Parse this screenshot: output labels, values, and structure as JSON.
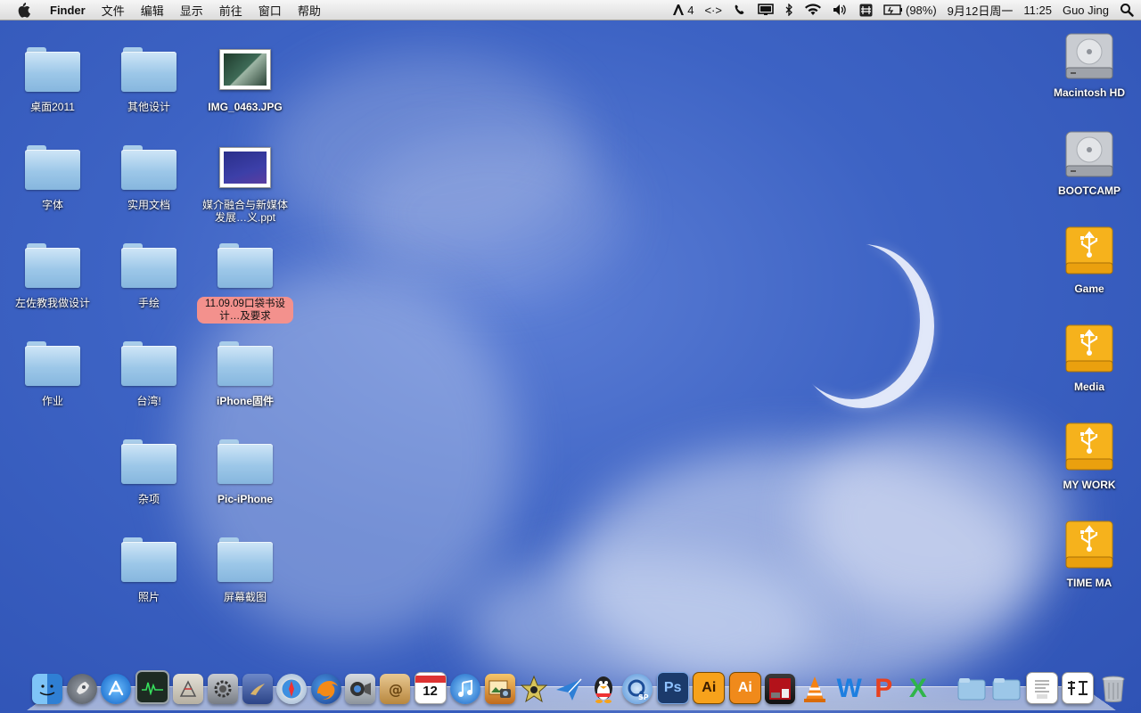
{
  "menubar": {
    "app_name": "Finder",
    "menus": [
      "文件",
      "编辑",
      "显示",
      "前往",
      "窗口",
      "帮助"
    ],
    "status": {
      "adobe_count": "4",
      "arrows": "<·>",
      "battery": "(98%)",
      "date": "9月12日周一",
      "time": "11:25",
      "user": "Guo Jing"
    }
  },
  "desktop_left": [
    {
      "label": "桌面2011",
      "kind": "folder"
    },
    {
      "label": "其他设计",
      "kind": "folder"
    },
    {
      "label": "IMG_0463.JPG",
      "kind": "image"
    },
    {
      "label": "字体",
      "kind": "folder"
    },
    {
      "label": "实用文档",
      "kind": "folder"
    },
    {
      "label": "媒介融合与新媒体发展…义.ppt",
      "kind": "ppt"
    },
    {
      "label": "左佐教我做设计",
      "kind": "folder"
    },
    {
      "label": "手绘",
      "kind": "folder"
    },
    {
      "label": "11.09.09口袋书设计…及要求",
      "kind": "folder",
      "tag": "red"
    },
    {
      "label": "作业",
      "kind": "folder"
    },
    {
      "label": "台湾!",
      "kind": "folder"
    },
    {
      "label": "iPhone固件",
      "kind": "folder"
    },
    {
      "label": "杂项",
      "kind": "folder"
    },
    {
      "label": "Pic-iPhone",
      "kind": "folder"
    },
    {
      "label": "照片",
      "kind": "folder"
    },
    {
      "label": "屏幕截图",
      "kind": "folder"
    }
  ],
  "desktop_right": [
    {
      "label": "Macintosh HD",
      "kind": "hdd"
    },
    {
      "label": "BOOTCAMP",
      "kind": "hdd"
    },
    {
      "label": "Game",
      "kind": "usb"
    },
    {
      "label": "Media",
      "kind": "usb"
    },
    {
      "label": "MY WORK",
      "kind": "usb"
    },
    {
      "label": "TIME MA",
      "kind": "usb"
    }
  ],
  "dock": {
    "calendar_day": "12",
    "ps_label": "Ps",
    "ai_label": "Ai",
    "ai2_label": "Ai",
    "w_label": "W",
    "p_label": "P",
    "x_label": "X",
    "colors": {
      "finder": "#5aa6e8",
      "ps": "#1b3a6b",
      "ai": "#f7a21b",
      "qq": "#222222"
    }
  }
}
